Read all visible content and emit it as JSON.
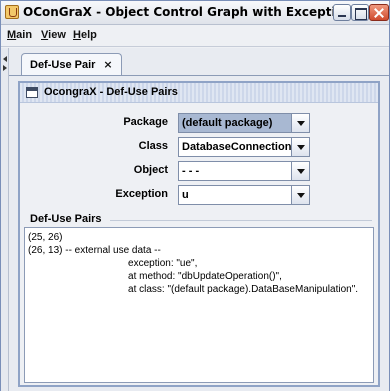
{
  "window": {
    "title": "OConGraX - Object Control Graph with Exceptions"
  },
  "menu": {
    "items": [
      {
        "label": "Main",
        "mnemonic": "M",
        "rest": "ain"
      },
      {
        "label": "View",
        "mnemonic": "V",
        "rest": "iew"
      },
      {
        "label": "Help",
        "mnemonic": "H",
        "rest": "elp"
      }
    ]
  },
  "tab": {
    "label": "Def-Use Pair",
    "close_glyph": "×"
  },
  "internal_frame": {
    "title": "OcongraX - Def-Use Pairs"
  },
  "form": {
    "package_label": "Package",
    "package_value": "(default package)",
    "class_label": "Class",
    "class_value": "DatabaseConnection",
    "object_label": "Object",
    "object_value": "- - -",
    "exception_label": "Exception",
    "exception_value": "u"
  },
  "results": {
    "group_label": "Def-Use Pairs",
    "text": "(25, 26)\n(26, 13) -- external use data --\n                                    exception: \"ue\",\n                                    at method: \"dbUpdateOperation()\",\n                                    at class: \"(default package).DataBaseManipulation\"."
  }
}
